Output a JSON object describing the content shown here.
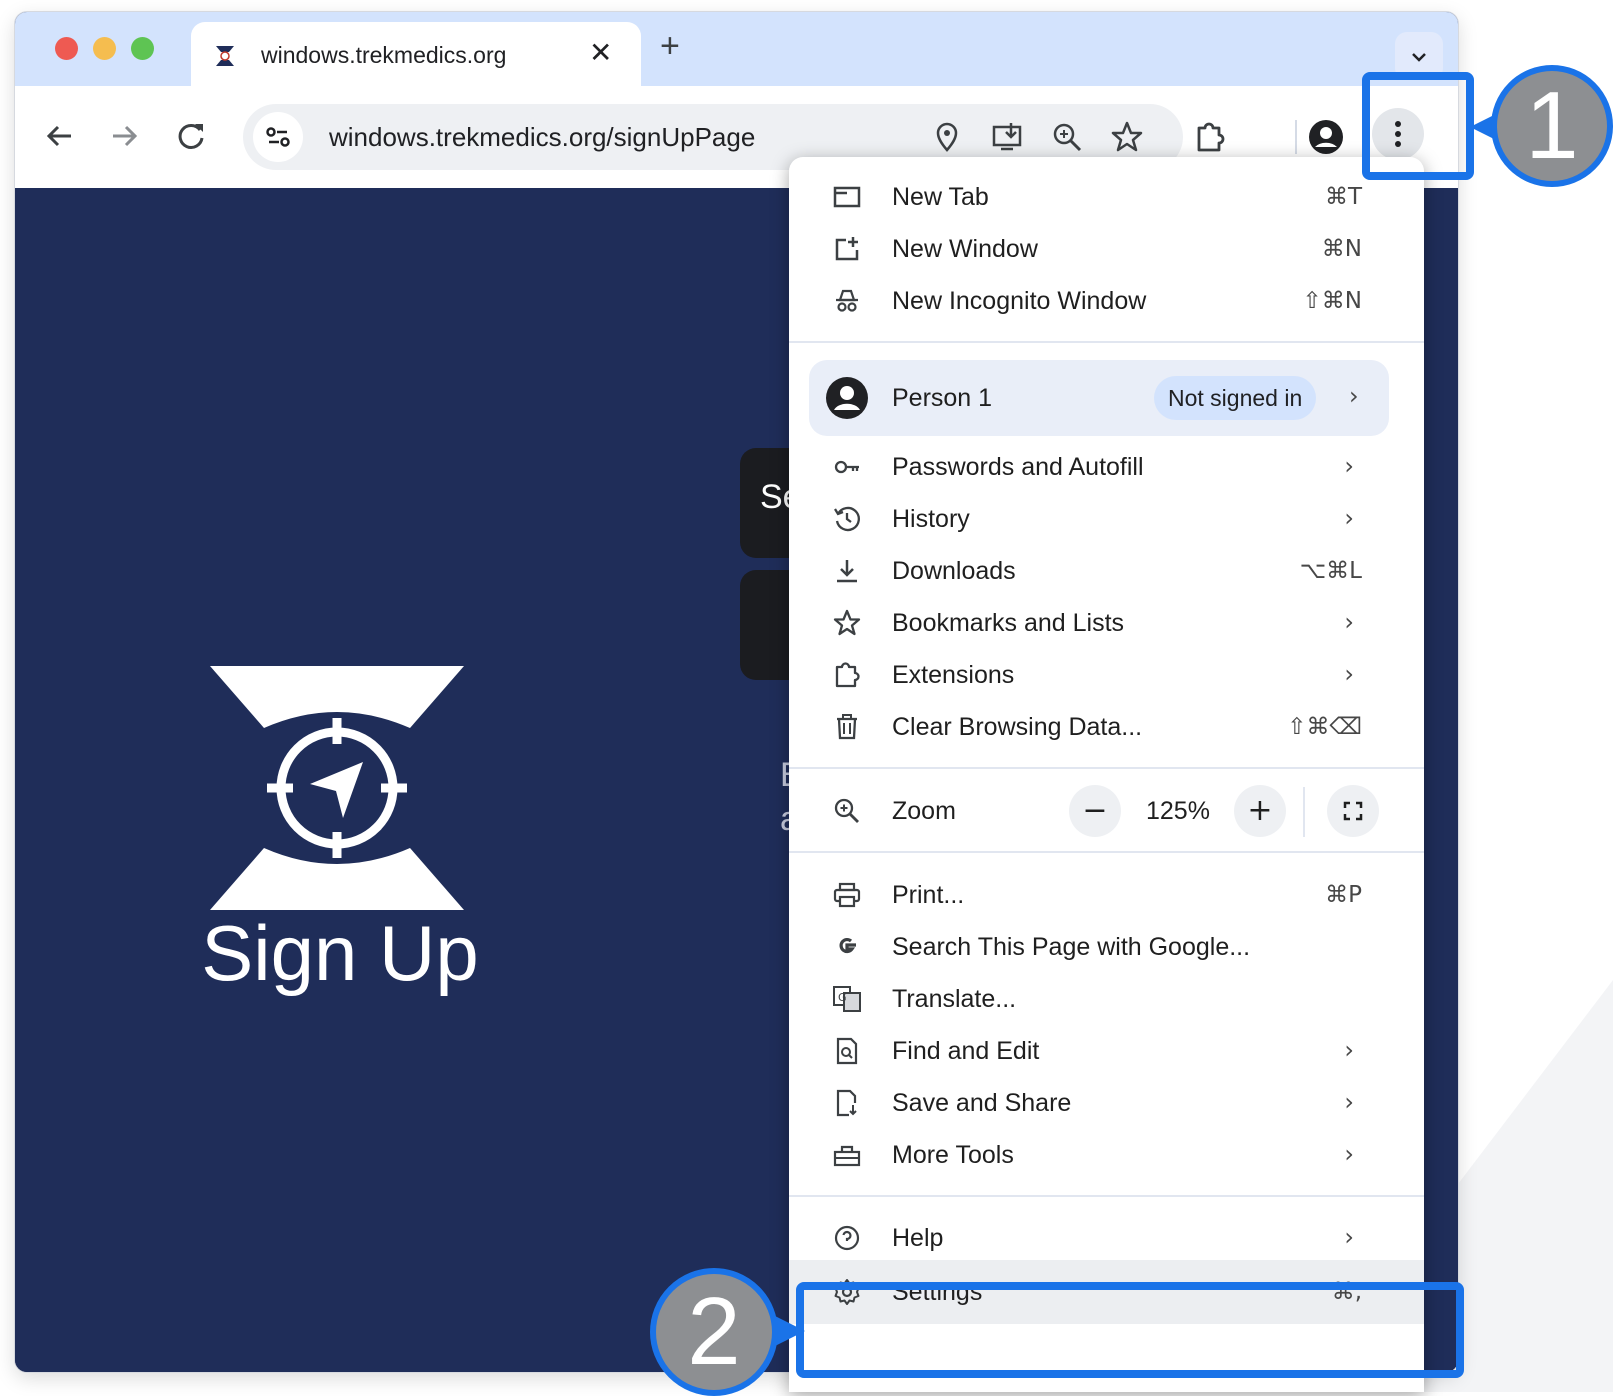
{
  "tab": {
    "title": "windows.trekmedics.org",
    "close": "✕",
    "new_tab": "+"
  },
  "toolbar": {
    "url": "windows.trekmedics.org/signUpPage"
  },
  "page": {
    "heading": "Sign Up",
    "card_text": "Se",
    "partial_line1": "B",
    "partial_line2": "a"
  },
  "menu": {
    "section1": [
      {
        "label": "New Tab",
        "shortcut": "⌘T",
        "icon": "new-tab-icon"
      },
      {
        "label": "New Window",
        "shortcut": "⌘N",
        "icon": "new-window-icon"
      },
      {
        "label": "New Incognito Window",
        "shortcut": "⇧⌘N",
        "icon": "incognito-icon"
      }
    ],
    "person": {
      "label": "Person 1",
      "status": "Not signed in"
    },
    "section2": [
      {
        "label": "Passwords and Autofill",
        "chev": "›",
        "icon": "key-icon"
      },
      {
        "label": "History",
        "chev": "›",
        "icon": "history-icon"
      },
      {
        "label": "Downloads",
        "shortcut": "⌥⌘L",
        "icon": "download-icon"
      },
      {
        "label": "Bookmarks and Lists",
        "chev": "›",
        "icon": "star-icon"
      },
      {
        "label": "Extensions",
        "chev": "›",
        "icon": "puzzle-icon"
      },
      {
        "label": "Clear Browsing Data...",
        "shortcut": "⇧⌘⌫",
        "icon": "trash-icon"
      }
    ],
    "zoom": {
      "label": "Zoom",
      "minus": "−",
      "value": "125%",
      "plus": "+"
    },
    "section3": [
      {
        "label": "Print...",
        "shortcut": "⌘P",
        "icon": "printer-icon"
      },
      {
        "label": "Search This Page with Google...",
        "icon": "google-icon"
      },
      {
        "label": "Translate...",
        "icon": "translate-icon"
      },
      {
        "label": "Find and Edit",
        "chev": "›",
        "icon": "find-icon"
      },
      {
        "label": "Save and Share",
        "chev": "›",
        "icon": "save-share-icon"
      },
      {
        "label": "More Tools",
        "chev": "›",
        "icon": "toolbox-icon"
      }
    ],
    "help": {
      "label": "Help",
      "chev": "›"
    },
    "settings": {
      "label": "Settings",
      "shortcut": "⌘,"
    }
  },
  "callouts": {
    "first": "1",
    "second": "2"
  },
  "colors": {
    "tabstrip": "#d3e3fd",
    "page_bg": "#1f2d59",
    "highlight": "#1a73e8",
    "callout_fill": "#8d8f92"
  }
}
